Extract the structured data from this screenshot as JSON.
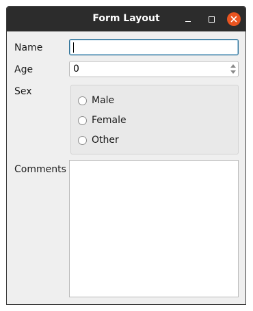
{
  "window": {
    "title": "Form Layout"
  },
  "form": {
    "name_label": "Name",
    "name_value": "",
    "age_label": "Age",
    "age_value": "0",
    "sex_label": "Sex",
    "sex_options": [
      {
        "label": "Male",
        "checked": false
      },
      {
        "label": "Female",
        "checked": false
      },
      {
        "label": "Other",
        "checked": false
      }
    ],
    "comments_label": "Comments",
    "comments_value": ""
  },
  "colors": {
    "titlebar": "#2c2c2c",
    "close_button": "#e95420",
    "window_bg": "#efefef",
    "focus_border": "#2b6f95"
  }
}
